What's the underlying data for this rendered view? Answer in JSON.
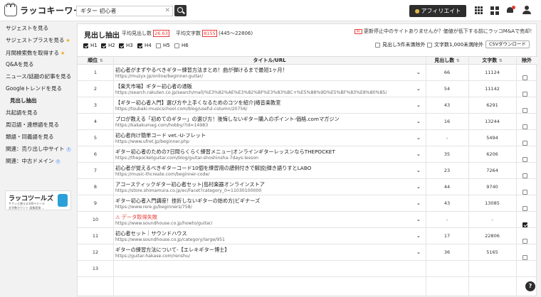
{
  "app": {
    "logo_text": "ラッコキーワード"
  },
  "search": {
    "value": "ギター 初心者",
    "clear_icon": "close-icon"
  },
  "header": {
    "affiliate_label": "アフィリエイト"
  },
  "sidebar": {
    "items": [
      {
        "label": "サジェストを見る"
      },
      {
        "label": "サジェストプラスを見る",
        "star": "★"
      },
      {
        "label": "月間検索数を取得する",
        "star": "★"
      },
      {
        "label": "Q&Aを見る"
      },
      {
        "label": "ニュース/話題の記事を見る"
      },
      {
        "label": "Googleトレンドを見る"
      },
      {
        "label": "見出し抽出"
      },
      {
        "label": "共起語を見る"
      },
      {
        "label": "周辺語・連想語を見る"
      },
      {
        "label": "類語・同義語を見る"
      },
      {
        "label": "関連：売り出し中サイト",
        "info": "i"
      },
      {
        "label": "関連：中古ドメイン",
        "info": "i"
      }
    ],
    "banner": {
      "title": "ラッコツールズ",
      "line1": "サクッと使える100+ツール",
      "line2": "文字数カウント  画像変換  …"
    }
  },
  "main": {
    "title": "見出し抽出",
    "avg_headings_label": "平均見出し数",
    "avg_headings_value": "26.63",
    "avg_chars_label": "平均文字数",
    "avg_chars_value": "8155",
    "chars_range": "(445〜22806)",
    "notice_badge": "PR",
    "notice": "更新停止中のサイトありませんか？価値が低下する前にラッコM&Aで売却！",
    "heading_filters": [
      {
        "label": "H1",
        "checked": true
      },
      {
        "label": "H2",
        "checked": true
      },
      {
        "label": "H3",
        "checked": true
      },
      {
        "label": "H4",
        "checked": true
      },
      {
        "label": "H5",
        "checked": false
      },
      {
        "label": "H6",
        "checked": false
      }
    ],
    "option_exclude_headings": "見出し5件未満除外",
    "option_exclude_chars": "文字数1,000未満除外",
    "csv_label": "CSVダウンロード",
    "columns": {
      "rank": "順位",
      "title_url": "タイトル/URL",
      "headings": "見出し数",
      "chars": "文字数",
      "exclude": "除外"
    }
  },
  "rows": [
    {
      "rank": "1",
      "title": "初心者がまずやるべきギター練習方法まとめ！曲が弾けるまで最短1ヶ月！",
      "url": "https://muzyx.jp/online/beginner-guitar/",
      "headings": "66",
      "chars": "11124",
      "exclude": false,
      "error": false
    },
    {
      "rank": "2",
      "title": "【楽天市場】ギター初心者の通販",
      "url": "https://search.rakuten.co.jp/search/mall/%E3%82%AE%E3%82%BF%E3%83%BC+%E5%88%9D%E5%BF%83%E8%80%85/",
      "headings": "54",
      "chars": "11142",
      "exclude": false,
      "error": false
    },
    {
      "rank": "3",
      "title": "【ギター初心者入門】選び方や上手くなるためのコツを紹介|椿音楽教室",
      "url": "https://tsubaki-musicschool.com/blog/useful-column/20756/",
      "headings": "43",
      "chars": "6291",
      "exclude": false,
      "error": false
    },
    {
      "rank": "4",
      "title": "プロが教える「初めてのギター」の選び方！後悔しないギター購入のポイント-価格.comマガジン",
      "url": "https://kakakumag.com/hobby/?id=14983",
      "headings": "16",
      "chars": "13244",
      "exclude": false,
      "error": false
    },
    {
      "rank": "5",
      "title": "初心者向け簡単コード vet.-U-フレット",
      "url": "https://www.ufret.jp/beginner.php",
      "headings": "-",
      "chars": "5494",
      "exclude": false,
      "error": false
    },
    {
      "rank": "6",
      "title": "ギター初心者のための7日間らくらく練習メニュー|オンラインギターレッスンならTHEPOCKET",
      "url": "https://thepocketguitar.com/blog/guitar-shoshinsha-7days-lesson",
      "headings": "35",
      "chars": "6206",
      "exclude": false,
      "error": false
    },
    {
      "rank": "7",
      "title": "初心者が覚えるべきギターコード10個を練習用の譜例付きで解説|弾き語りすとLABO",
      "url": "https://music-thcreate.com/beginner-code/",
      "headings": "23",
      "chars": "7264",
      "exclude": false,
      "error": false
    },
    {
      "rank": "8",
      "title": "アコースティックギター初心者セット|島村楽器オンラインストア",
      "url": "https://store.shimamura.co.jp/ec/Facet?category_0=11030100000",
      "headings": "44",
      "chars": "9740",
      "exclude": false,
      "error": false
    },
    {
      "rank": "9",
      "title": "ギター初心者入門講座！挫折しないギターの始め方|ビギナーズ",
      "url": "https://www.rere.jp/beginners/758/",
      "headings": "43",
      "chars": "13085",
      "exclude": false,
      "error": false
    },
    {
      "rank": "10",
      "title": "データ取得失敗",
      "url": "https://www.soundhouse.co.jp/howto/guitar/",
      "headings": "-",
      "chars": "-",
      "exclude": true,
      "error": true
    },
    {
      "rank": "11",
      "title": "初心者セット｜サウンドハウス",
      "url": "https://www.soundhouse.co.jp/category/large/951",
      "headings": "17",
      "chars": "22806",
      "exclude": false,
      "error": false
    },
    {
      "rank": "12",
      "title": "ギターの練習方法について-【エレキギター博士】",
      "url": "https://guitar-hakase.com/renshu/",
      "headings": "36",
      "chars": "5165",
      "exclude": false,
      "error": false
    },
    {
      "rank": "13",
      "title": "",
      "url": "",
      "headings": "",
      "chars": "",
      "exclude": false,
      "error": false
    }
  ]
}
